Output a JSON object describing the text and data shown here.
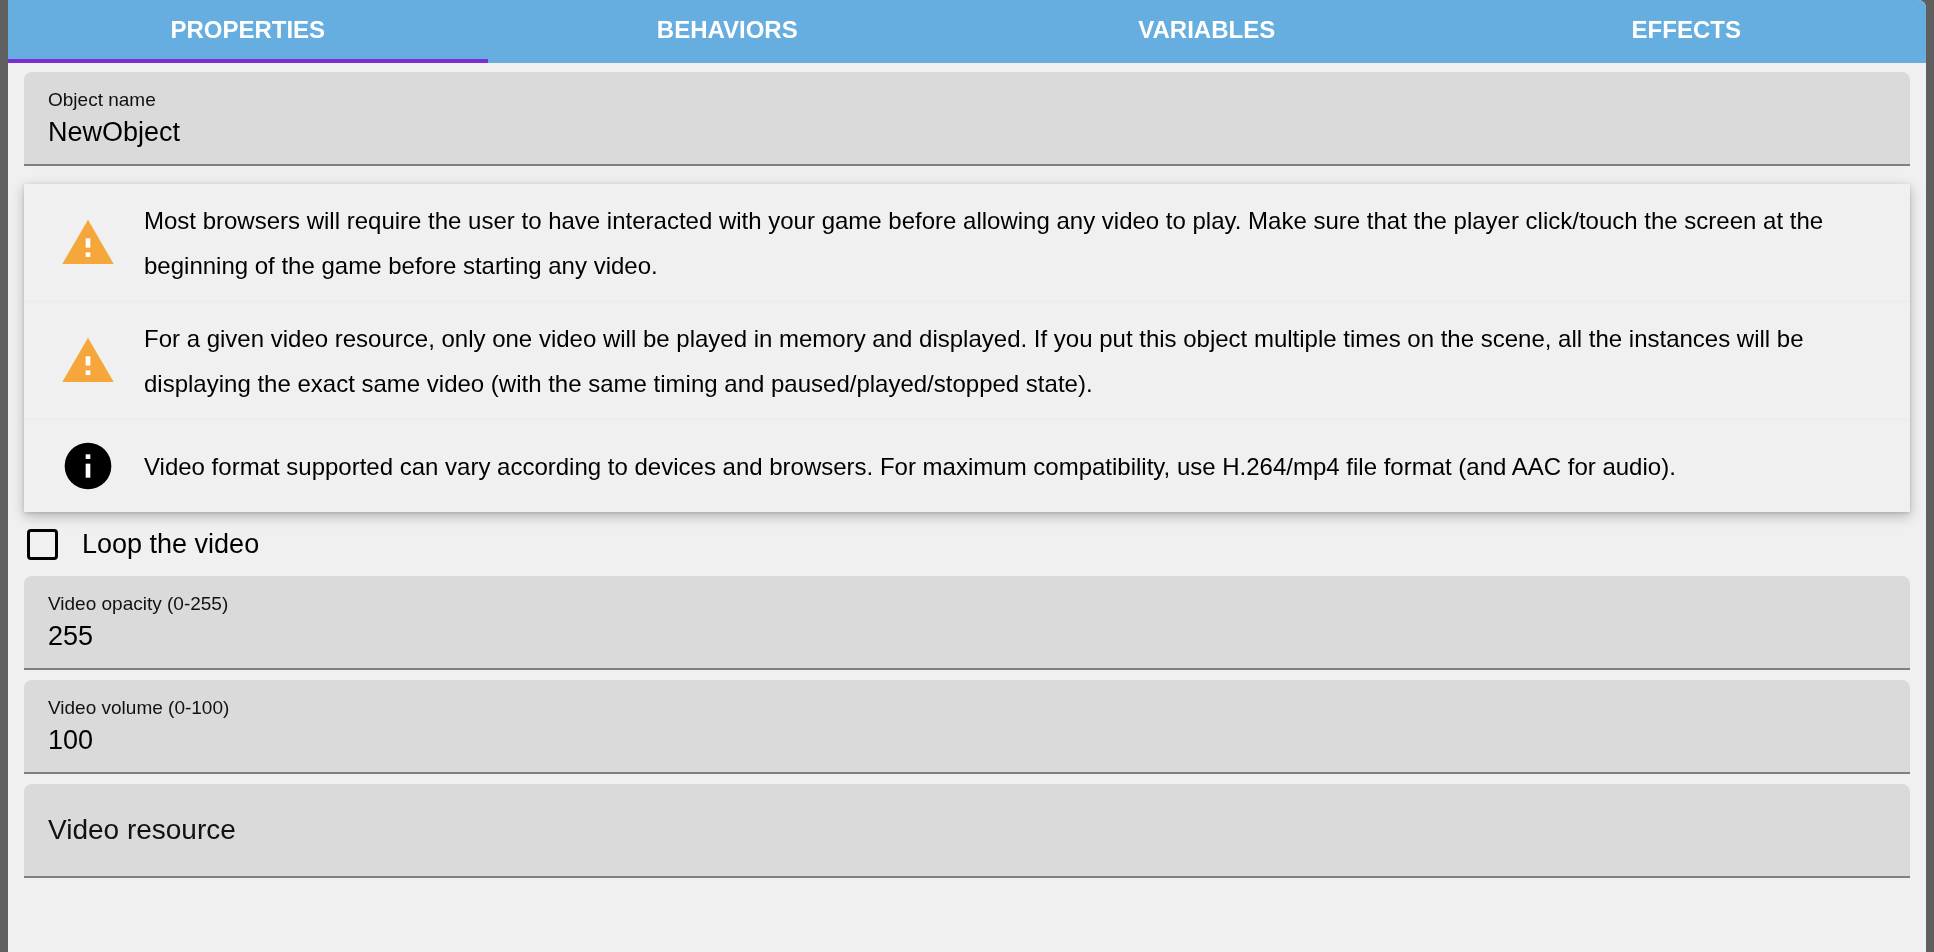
{
  "tabs": [
    {
      "label": "PROPERTIES",
      "selected": true
    },
    {
      "label": "BEHAVIORS",
      "selected": false
    },
    {
      "label": "VARIABLES",
      "selected": false
    },
    {
      "label": "EFFECTS",
      "selected": false
    }
  ],
  "object_name": {
    "label": "Object name",
    "value": "NewObject"
  },
  "alerts": [
    {
      "kind": "warning",
      "text": "Most browsers will require the user to have interacted with your game before allowing any video to play. Make sure that the player click/touch the screen at the beginning of the game before starting any video."
    },
    {
      "kind": "warning",
      "text": "For a given video resource, only one video will be played in memory and displayed. If you put this object multiple times on the scene, all the instances will be displaying the exact same video (with the same timing and paused/played/stopped state)."
    },
    {
      "kind": "info",
      "text": "Video format supported can vary according to devices and browsers. For maximum compatibility, use H.264/mp4 file format (and AAC for audio)."
    }
  ],
  "loop_checkbox": {
    "label": "Loop the video",
    "checked": false
  },
  "fields": [
    {
      "label": "Video opacity (0-255)",
      "value": "255"
    },
    {
      "label": "Video volume (0-100)",
      "value": "100"
    },
    {
      "label": "Video resource"
    }
  ]
}
